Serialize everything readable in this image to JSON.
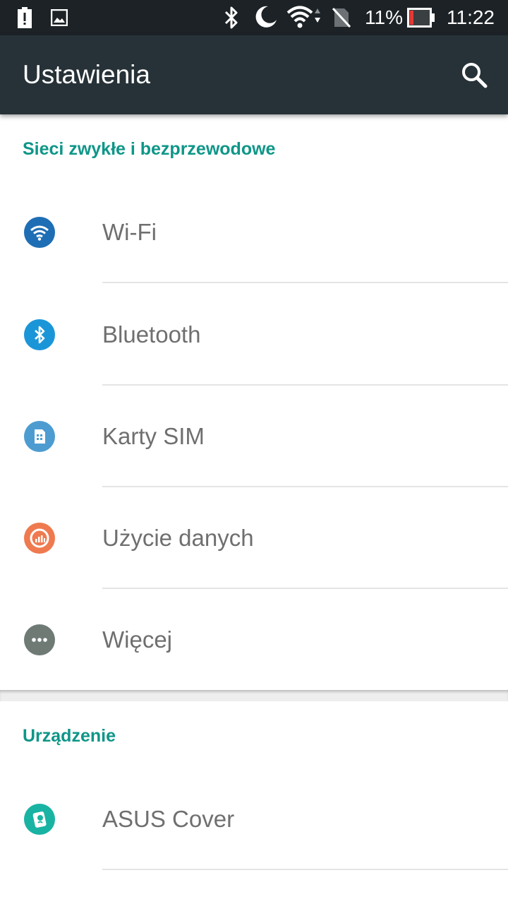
{
  "status_bar": {
    "battery_percent": "11%",
    "time": "11:22",
    "icons": [
      "alert-battery-icon",
      "image-icon",
      "bluetooth-icon",
      "moon-icon",
      "wifi-icon",
      "no-sim-icon",
      "battery-icon"
    ]
  },
  "toolbar": {
    "title": "Ustawienia",
    "search_icon": "search-icon"
  },
  "sections": [
    {
      "header": "Sieci zwykłe i bezprzewodowe",
      "items": [
        {
          "label": "Wi-Fi",
          "icon": "wifi-icon",
          "color": "#1e6eb5"
        },
        {
          "label": "Bluetooth",
          "icon": "bluetooth-icon",
          "color": "#1a96d8"
        },
        {
          "label": "Karty SIM",
          "icon": "sim-card-icon",
          "color": "#4d9cd1"
        },
        {
          "label": "Użycie danych",
          "icon": "data-usage-icon",
          "color": "#ef7a50"
        },
        {
          "label": "Więcej",
          "icon": "more-icon",
          "color": "#6f7a75"
        }
      ]
    },
    {
      "header": "Urządzenie",
      "items": [
        {
          "label": "ASUS Cover",
          "icon": "asus-cover-icon",
          "color": "#19b3a3"
        }
      ]
    }
  ],
  "colors": {
    "toolbar": "#263238",
    "status_bar": "#1c2226",
    "accent": "#0e9688",
    "item_text": "#6f6f6f"
  }
}
